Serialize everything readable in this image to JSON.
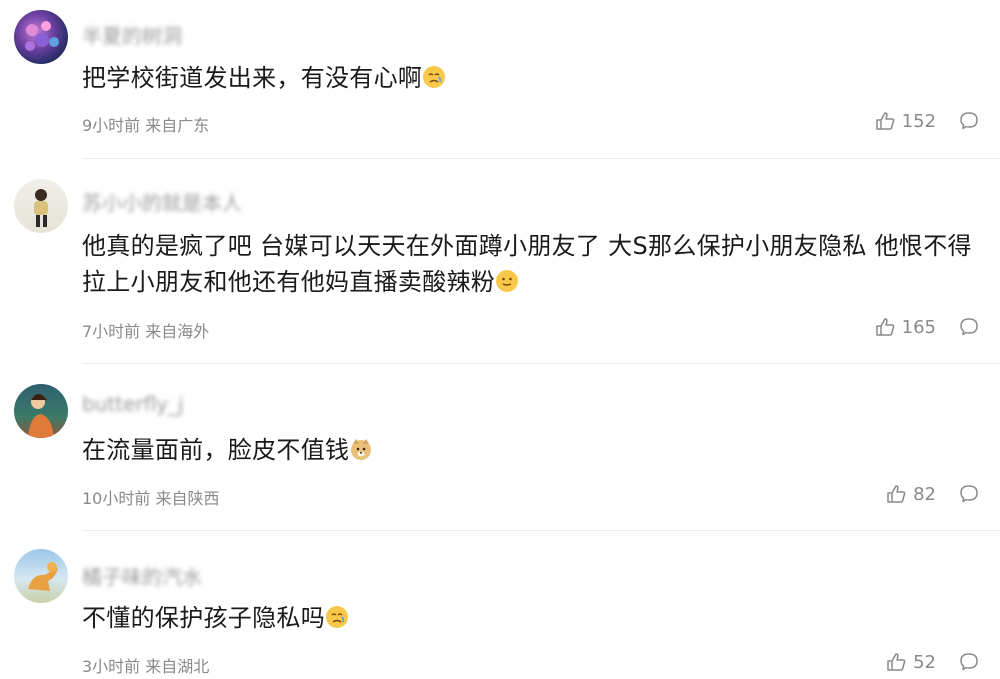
{
  "comments": [
    {
      "username": "半夏的树洞",
      "text": "把学校街道发出来，有没有心啊",
      "meta": "9小时前 来自广东",
      "likes": "152"
    },
    {
      "username": "苏小小的就是本人",
      "text": "他真的是疯了吧 台媒可以天天在外面蹲小朋友了 大S那么保护小朋友隐私 他恨不得拉上小朋友和他还有他妈直播卖酸辣粉",
      "meta": "7小时前 来自海外",
      "likes": "165"
    },
    {
      "username": "butterfly_j",
      "text": "在流量面前，脸皮不值钱",
      "meta": "10小时前 来自陕西",
      "likes": "82"
    },
    {
      "username": "橘子味的汽水",
      "text": "不懂的保护孩子隐私吗",
      "meta": "3小时前 来自湖北",
      "likes": "52"
    }
  ],
  "icons": {
    "like": "thumbs-up-icon",
    "comment": "comment-bubble-icon"
  }
}
